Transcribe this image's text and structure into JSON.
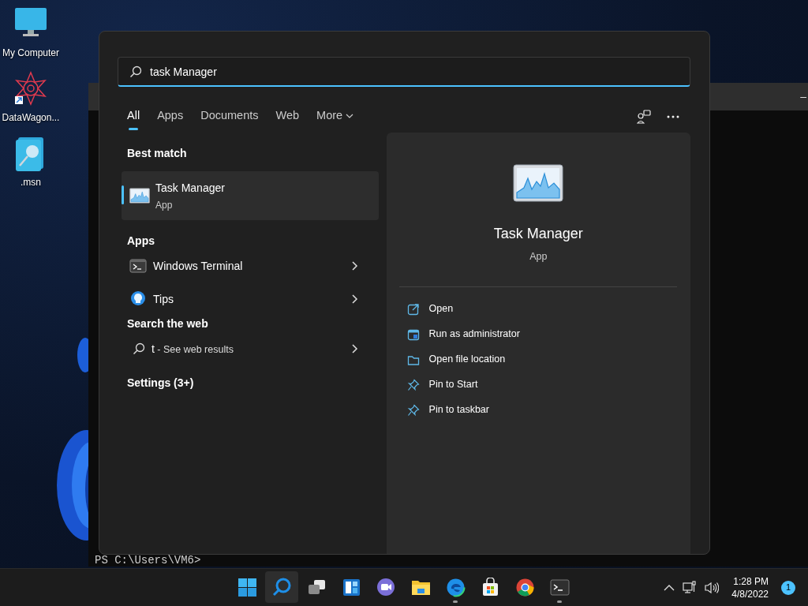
{
  "desktop_icons": [
    {
      "label": "My Computer",
      "kind": "monitor"
    },
    {
      "label": "DataWagon...",
      "kind": "shortcut"
    },
    {
      "label": ".msn",
      "kind": "file"
    }
  ],
  "terminal": {
    "window_control": "–",
    "prompt": "PS C:\\Users\\VM6>"
  },
  "search": {
    "value": "task Manager"
  },
  "tabs": [
    {
      "label": "All",
      "selected": true,
      "kind": "tab"
    },
    {
      "label": "Apps",
      "selected": false,
      "kind": "tab"
    },
    {
      "label": "Documents",
      "selected": false,
      "kind": "tab"
    },
    {
      "label": "Web",
      "selected": false,
      "kind": "tab"
    },
    {
      "label": "More",
      "selected": false,
      "kind": "dropdown"
    }
  ],
  "best_match": {
    "heading": "Best match",
    "title": "Task Manager",
    "subtitle": "App",
    "selected": true
  },
  "apps": {
    "heading": "Apps",
    "items": [
      {
        "label": "Windows Terminal",
        "kind": "terminal"
      },
      {
        "label": "Tips",
        "kind": "tips"
      }
    ]
  },
  "web": {
    "heading": "Search the web",
    "query": "t",
    "hint": " - See web results"
  },
  "settings": {
    "heading": "Settings (3+)"
  },
  "detail": {
    "title": "Task Manager",
    "subtitle": "App",
    "actions": [
      {
        "label": "Open",
        "kind": "open"
      },
      {
        "label": "Run as administrator",
        "kind": "admin"
      },
      {
        "label": "Open file location",
        "kind": "folder"
      },
      {
        "label": "Pin to Start",
        "kind": "pin"
      },
      {
        "label": "Pin to taskbar",
        "kind": "pin"
      }
    ]
  },
  "taskbar": {
    "items": [
      {
        "kind": "start",
        "selected": false,
        "running": false
      },
      {
        "kind": "search",
        "selected": true,
        "running": false
      },
      {
        "kind": "taskview",
        "selected": false,
        "running": false
      },
      {
        "kind": "widgets",
        "selected": false,
        "running": false
      },
      {
        "kind": "chat",
        "selected": false,
        "running": false
      },
      {
        "kind": "explorer",
        "selected": false,
        "running": false
      },
      {
        "kind": "edge",
        "selected": false,
        "running": true
      },
      {
        "kind": "store",
        "selected": false,
        "running": false
      },
      {
        "kind": "chrome",
        "selected": false,
        "running": false
      },
      {
        "kind": "terminal",
        "selected": false,
        "running": true
      }
    ],
    "time": "1:28 PM",
    "date": "4/8/2022",
    "notifications": "1"
  }
}
